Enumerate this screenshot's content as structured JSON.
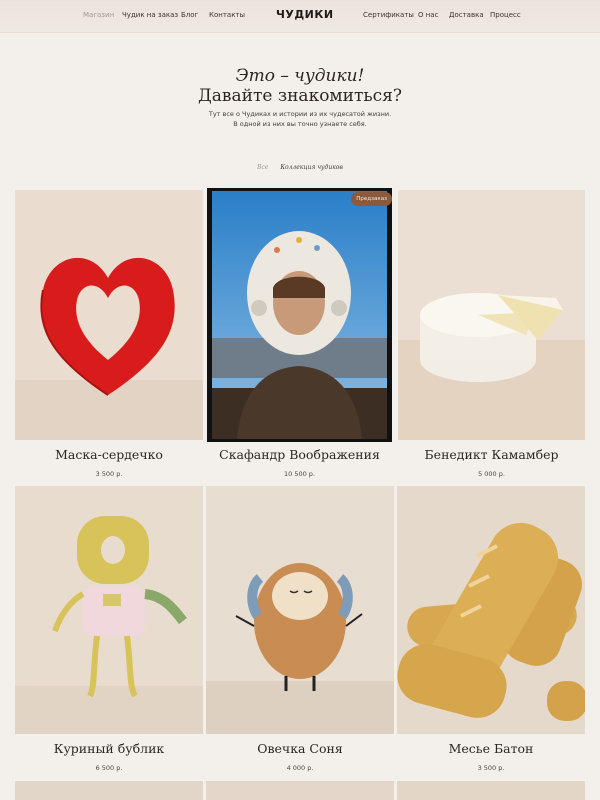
{
  "header": {
    "nav_left": [
      "Магазин",
      "Чудик на заказ",
      "Блог",
      "Контакты"
    ],
    "logo": "ЧУДИКИ",
    "nav_right": [
      "Сертификаты",
      "О нас",
      "Доставка",
      "Процесс"
    ]
  },
  "hero": {
    "line1": "Это – чудики!",
    "line2": "Давайте знакомиться?",
    "desc1": "Тут все о Чудиках и истории из их чудесатой жизни.",
    "desc2": "В одной из них вы точно узнаете себя."
  },
  "filters": {
    "all": "Все",
    "collection": "Коллекция чудиков"
  },
  "products": [
    {
      "name": "Маска-сердечко",
      "price": "3 500 р."
    },
    {
      "name": "Скафандр Воображения",
      "price": "10 500 р.",
      "badge": "Предзаказ"
    },
    {
      "name": "Бенедикт Камамбер",
      "price": "5 000 р."
    },
    {
      "name": "Куриный бублик",
      "price": "6 500 р."
    },
    {
      "name": "Овечка Соня",
      "price": "4 000 р."
    },
    {
      "name": "Месье Батон",
      "price": "3 500 р."
    }
  ],
  "colors": {
    "background": "#f3f0ec",
    "header": "#ebe3db",
    "badge": "#8b5a3c",
    "nav_active": "#a29990"
  }
}
